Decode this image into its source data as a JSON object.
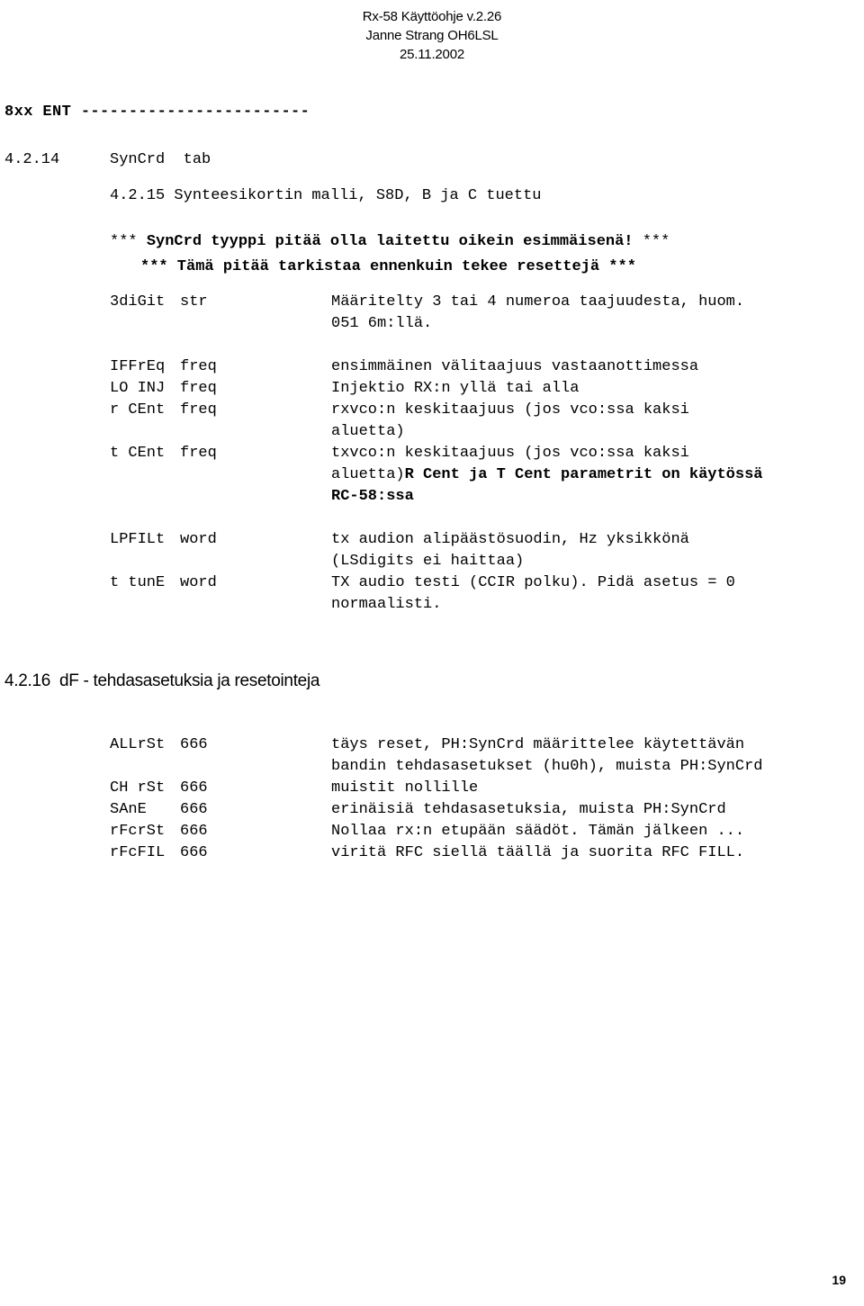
{
  "header": {
    "line1": "Rx-58 Käyttöohje v.2.26",
    "line2": "Janne Strang OH6LSL",
    "line3": "25.11.2002"
  },
  "ent_rule": {
    "label": "8xx ENT",
    "dashes": " ------------------------"
  },
  "section_4_2_14": {
    "number": "4.2.14",
    "title": "SynCrd  tab"
  },
  "section_4_2_15": {
    "text": "4.2.15 Synteesikortin malli, S8D, B ja C tuettu"
  },
  "warning": {
    "stars_open": "*** ",
    "line1": "SynCrd tyyppi pitää olla laitettu oikein esimmäisenä!",
    "stars_close": " ***",
    "line2": "*** Tämä pitää tarkistaa ennenkuin tekee resettejä ***"
  },
  "block_3digit": {
    "rows": [
      {
        "name": "3diGit",
        "type": "str",
        "desc": "Määritelty 3 tai 4 numeroa taajuudesta, huom.",
        "cont": [
          "051 6m:llä."
        ]
      }
    ]
  },
  "block_params": {
    "rows": [
      {
        "name": "IFFrEq",
        "type": "freq",
        "desc": "ensimmäinen välitaajuus vastaanottimessa",
        "cont": []
      },
      {
        "name": "LO INJ",
        "type": "freq",
        "desc": "Injektio RX:n yllä tai alla",
        "cont": []
      },
      {
        "name": "r CEnt",
        "type": "freq",
        "desc": "rxvco:n keskitaajuus (jos vco:ssa kaksi",
        "cont": [
          "aluetta)"
        ]
      },
      {
        "name": "t CEnt",
        "type": "freq",
        "desc": "txvco:n keskitaajuus (jos vco:ssa kaksi",
        "cont": [
          "aluetta)"
        ],
        "cont_bold_tail": "R Cent ja T Cent parametrit on käytössä",
        "cont_bold_line2": "RC-58:ssa"
      }
    ]
  },
  "block_lpf": {
    "rows": [
      {
        "name": "LPFILt",
        "type": "word",
        "desc": "tx audion alipäästösuodin, Hz yksikkönä",
        "cont": [
          "(LSdigits ei haittaa)"
        ]
      },
      {
        "name": "t tunE",
        "type": "word",
        "desc": "TX audio testi (CCIR polku). Pidä asetus = 0",
        "cont": [
          "normaalisti."
        ]
      }
    ]
  },
  "section_4_2_16": {
    "text": "4.2.16  dF - tehdasasetuksia ja resetointeja"
  },
  "block_df": {
    "rows": [
      {
        "name": "ALLrSt",
        "type": "666",
        "desc": "täys reset, PH:SynCrd määrittelee käytettävän",
        "cont": [
          "bandin tehdasasetukset (hu0h), muista PH:SynCrd"
        ]
      },
      {
        "name": "CH rSt",
        "type": "666",
        "desc": "muistit nollille",
        "cont": []
      },
      {
        "name": "SAnE",
        "type": "666",
        "desc": "erinäisiä tehdasasetuksia, muista PH:SynCrd",
        "cont": []
      },
      {
        "name": "rFcrSt",
        "type": "666",
        "desc": "Nollaa rx:n etupään säädöt. Tämän jälkeen ...",
        "cont": []
      },
      {
        "name": "rFcFIL",
        "type": "666",
        "desc": "viritä RFC siellä täällä ja suorita RFC FILL.",
        "cont": []
      }
    ]
  },
  "page_number": "19"
}
